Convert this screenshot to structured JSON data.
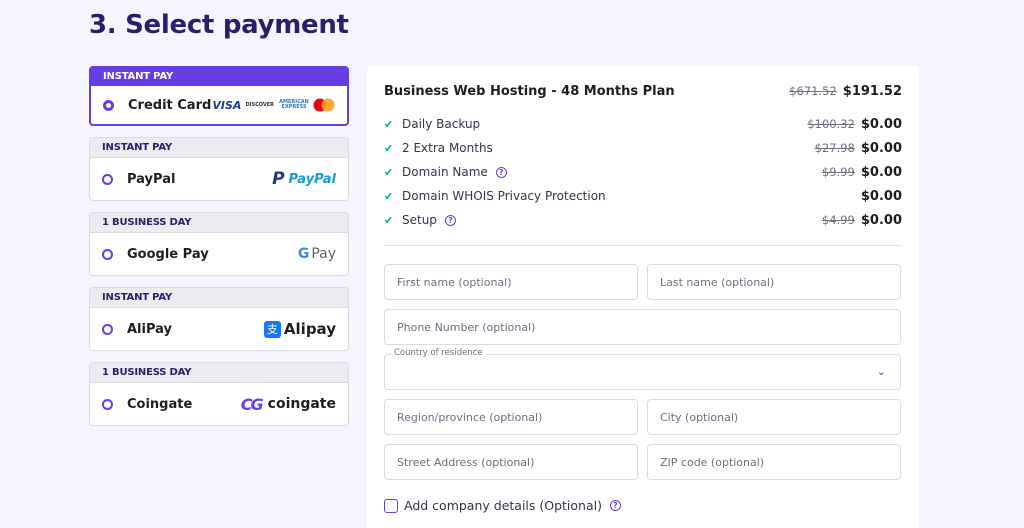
{
  "page": {
    "title": "3. Select payment"
  },
  "payment_methods": [
    {
      "tag": "INSTANT PAY",
      "name": "Credit Card",
      "selected": true,
      "logos": [
        "VISA",
        "DISCOVER",
        "AMERICAN EXPRESS",
        "Mastercard"
      ]
    },
    {
      "tag": "INSTANT PAY",
      "name": "PayPal",
      "selected": false,
      "logo_text": "PayPal"
    },
    {
      "tag": "1 BUSINESS DAY",
      "name": "Google Pay",
      "selected": false,
      "logo_text": "Pay"
    },
    {
      "tag": "INSTANT PAY",
      "name": "AliPay",
      "selected": false,
      "logo_text": "Alipay"
    },
    {
      "tag": "1 BUSINESS DAY",
      "name": "Coingate",
      "selected": false,
      "logo_text": "coingate"
    }
  ],
  "summary": {
    "plan_name": "Business Web Hosting - 48 Months Plan",
    "plan_old_price": "$671.52",
    "plan_price": "$191.52",
    "features": [
      {
        "name": "Daily Backup",
        "old_price": "$100.32",
        "price": "$0.00",
        "help": false
      },
      {
        "name": "2 Extra Months",
        "old_price": "$27.98",
        "price": "$0.00",
        "help": false
      },
      {
        "name": "Domain Name",
        "old_price": "$9.99",
        "price": "$0.00",
        "help": true
      },
      {
        "name": "Domain WHOIS Privacy Protection",
        "old_price": "",
        "price": "$0.00",
        "help": false
      },
      {
        "name": "Setup",
        "old_price": "$4.99",
        "price": "$0.00",
        "help": true
      }
    ]
  },
  "form": {
    "first_name": {
      "placeholder": "First name (optional)",
      "value": ""
    },
    "last_name": {
      "placeholder": "Last name (optional)",
      "value": ""
    },
    "phone": {
      "placeholder": "Phone Number (optional)",
      "value": ""
    },
    "country": {
      "label": "Country of residence",
      "value": ""
    },
    "region": {
      "placeholder": "Region/province (optional)",
      "value": ""
    },
    "city": {
      "placeholder": "City (optional)",
      "value": ""
    },
    "street": {
      "placeholder": "Street Address (optional)",
      "value": ""
    },
    "zip": {
      "placeholder": "ZIP code (optional)",
      "value": ""
    },
    "company_checkbox_label": "Add company details (Optional)",
    "company_checked": false
  },
  "colors": {
    "accent": "#673de6",
    "heading": "#2f1c6a",
    "check": "#00b090",
    "background": "#f4f5ff"
  }
}
